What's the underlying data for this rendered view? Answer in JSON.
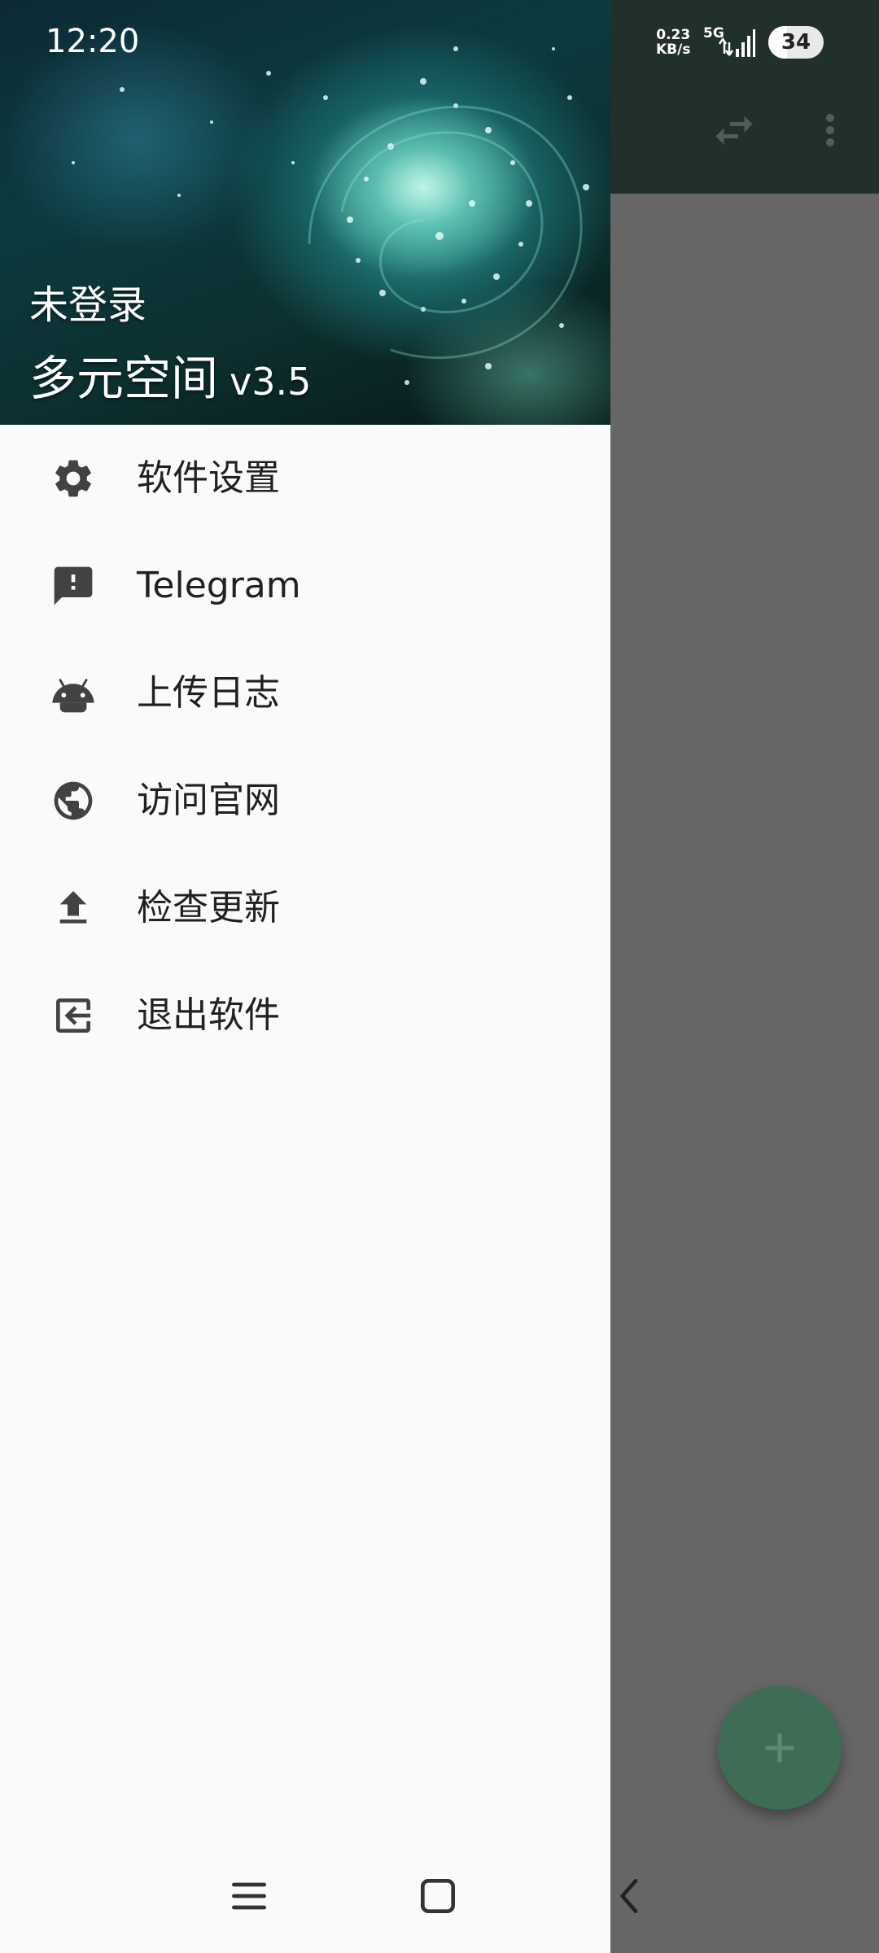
{
  "status_bar": {
    "time": "12:20",
    "net_speed_value": "0.23",
    "net_speed_unit": "KB/s",
    "network": "5G",
    "battery": "34",
    "battery_level": 0.34
  },
  "drawer": {
    "header": {
      "user_status": "未登录",
      "app_name": "多元空间",
      "version": "v3.5"
    },
    "menu": [
      {
        "label": "软件设置",
        "icon": "gear-icon"
      },
      {
        "label": "Telegram",
        "icon": "feedback-icon"
      },
      {
        "label": "上传日志",
        "icon": "android-icon"
      },
      {
        "label": "访问官网",
        "icon": "globe-icon"
      },
      {
        "label": "检查更新",
        "icon": "upload-icon"
      },
      {
        "label": "退出软件",
        "icon": "exit-icon"
      }
    ]
  },
  "colors": {
    "toolbar": "#21302a",
    "scrim": "#666666",
    "fab": "#3e6d55",
    "drawer_bg": "#fafafa",
    "icon": "#424242"
  },
  "background_toolbar_icons": [
    "swap-icon",
    "more-vert-icon"
  ],
  "fab_icon": "add-icon",
  "nav_bar_icons": [
    "recent-apps-icon",
    "home-icon",
    "back-icon"
  ]
}
